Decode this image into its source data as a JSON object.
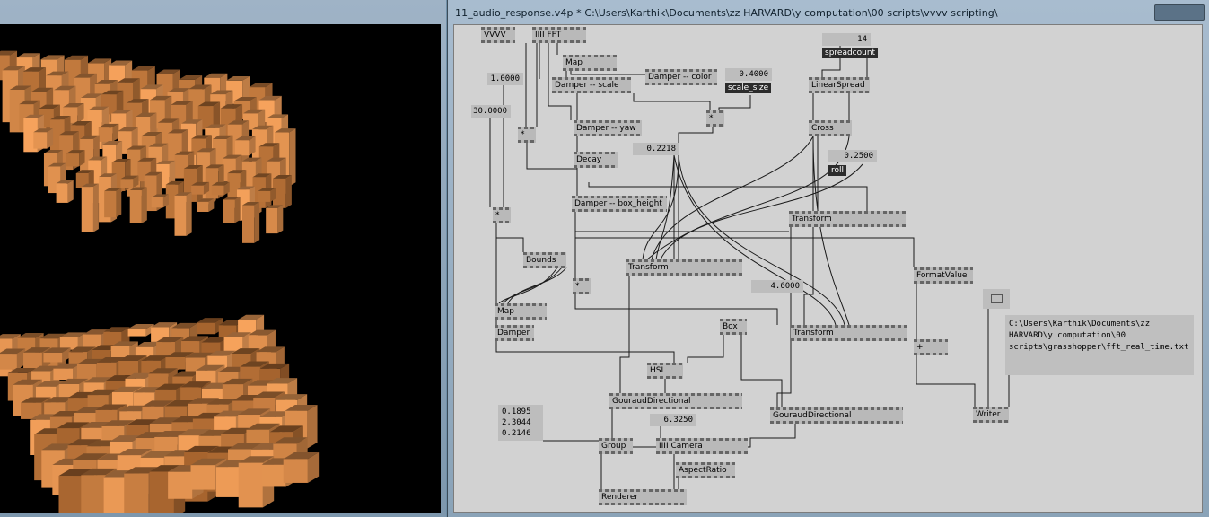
{
  "patch_window": {
    "title": "11_audio_response.v4p *  C:\\Users\\Karthik\\Documents\\zz HARVARD\\y computation\\00 scripts\\vvvv scripting\\"
  },
  "nodes": {
    "vvvv": "VVVV",
    "fft": "IIII FFT",
    "map1": "Map",
    "damper_color": "Damper -- color",
    "damper_scale": "Damper -- scale",
    "mult1": "*",
    "mult2": "*",
    "damper_yaw": "Damper -- yaw",
    "decay": "Decay",
    "damper_box_height": "Damper -- box_height",
    "mult3": "*",
    "bounds": "Bounds",
    "mult4": "*",
    "map2": "Map",
    "damper2": "Damper",
    "transform1": "Transform",
    "transform2": "Transform",
    "transform3": "Transform",
    "linearspread": "LinearSpread",
    "cross": "Cross",
    "box": "Box",
    "hsl": "HSL",
    "gouraud1": "GouraudDirectional",
    "gouraud2": "GouraudDirectional",
    "group": "Group",
    "camera": "IIII Camera",
    "aspectratio": "AspectRatio",
    "renderer": "Renderer",
    "formatvalue": "FormatValue",
    "plus": "+",
    "writer": "Writer"
  },
  "values": {
    "spread_count_value": "14",
    "scale_size_value": "0.4000",
    "v1": "1.0000",
    "v30": "30.0000",
    "v2218": "0.2218",
    "roll_value": "0.2500",
    "v46": "4.6000",
    "v6325": "6.3250",
    "vec": [
      "0.1895",
      "2.3044",
      "0.2146"
    ]
  },
  "labels": {
    "spreadcount": "spreadcount",
    "scale_size": "scale_size",
    "roll": "roll"
  },
  "file_path": "C:\\Users\\Karthik\\Documents\\zz\nHARVARD\\y computation\\00\nscripts\\grasshopper\\fft_real_time.txt",
  "colors": {
    "canvas": "#d2d2d2",
    "node": "#b9b9b9",
    "wire": "#1a1a1a",
    "box_light": "#f7a35c",
    "box_dark": "#8a4e1e"
  }
}
